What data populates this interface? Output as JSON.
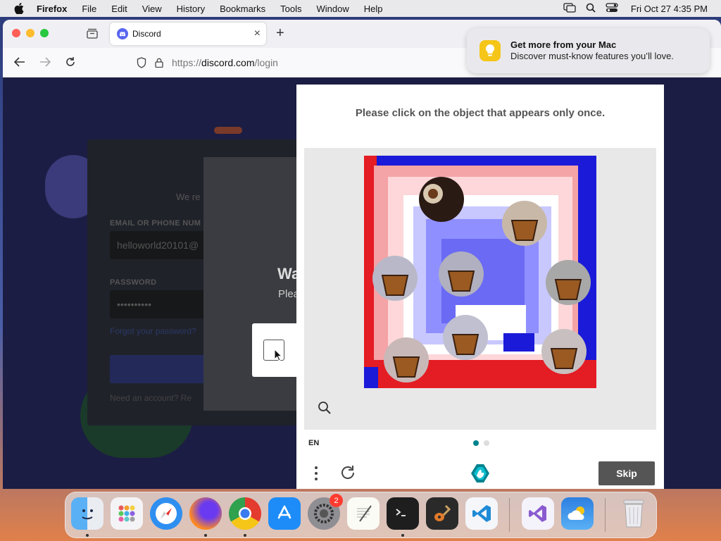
{
  "menubar": {
    "app_name": "Firefox",
    "menus": [
      "File",
      "Edit",
      "View",
      "History",
      "Bookmarks",
      "Tools",
      "Window",
      "Help"
    ],
    "clock": "Fri Oct 27  4:35 PM"
  },
  "browser": {
    "tab_title": "Discord",
    "url_prefix": "https://",
    "url_host": "discord.com",
    "url_path": "/login"
  },
  "notification": {
    "title": "Get more from your Mac",
    "text": "Discover must-know features you’ll love."
  },
  "login": {
    "subtitle": "We re",
    "email_label": "EMAIL OR PHONE NUM",
    "email_value": "helloworld20101@",
    "password_label": "PASSWORD",
    "password_value": "••••••••••",
    "forgot_link": "Forgot your password?",
    "register_text": "Need an account? Re",
    "modal_title": "Wa",
    "modal_text": "Plea"
  },
  "captcha": {
    "prompt": "Please click on the object that appears only once.",
    "language": "EN",
    "skip_label": "Skip",
    "progress": {
      "current": 1,
      "total": 2
    }
  },
  "dock": {
    "apps": [
      "Finder",
      "Launchpad",
      "Safari",
      "Firefox",
      "Chrome",
      "App Store",
      "System Settings",
      "TextEdit",
      "Terminal",
      "GarageBand",
      "Visual Studio Code",
      "Visual Studio",
      "Weather",
      "Trash"
    ],
    "settings_badge": "2"
  },
  "colors": {
    "captcha_accent": "#00838f",
    "discord_brand": "#5865f2",
    "skip_button": "#555555"
  }
}
